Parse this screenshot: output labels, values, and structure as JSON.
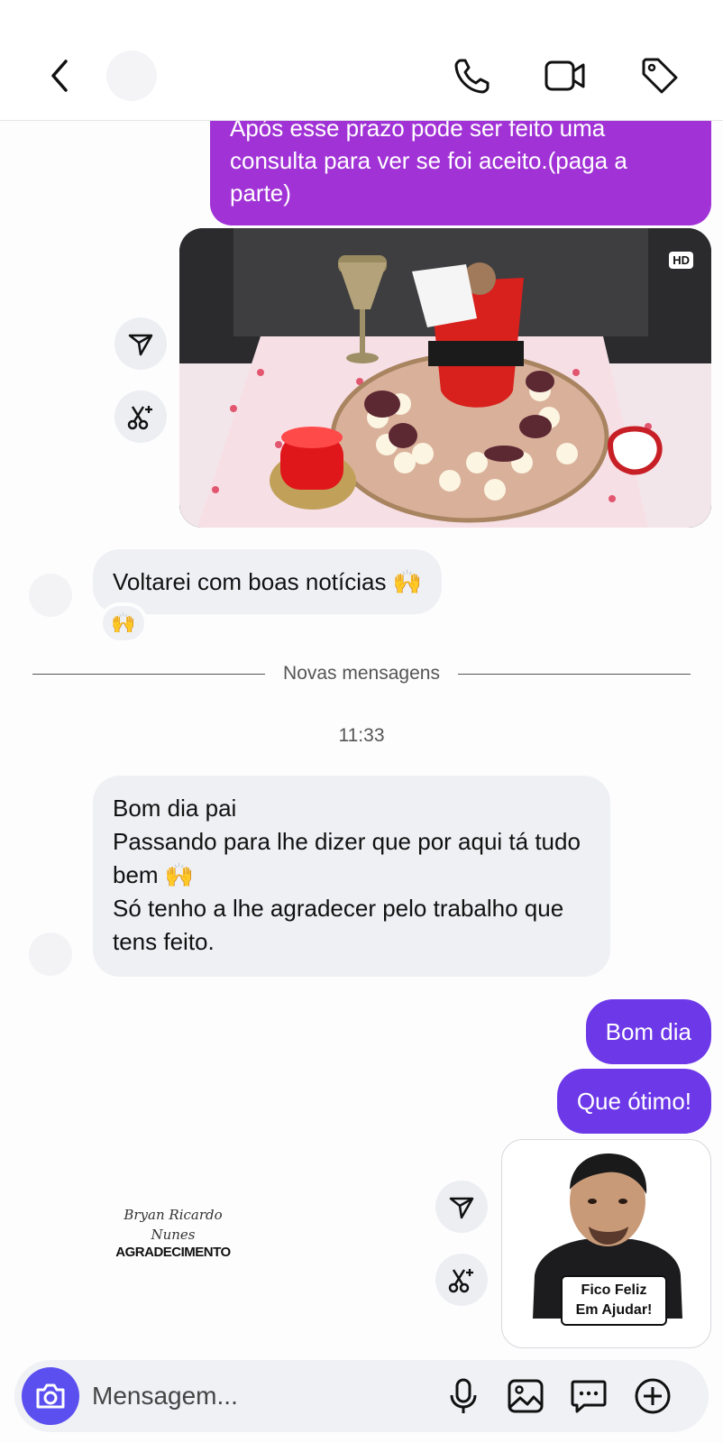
{
  "header": {
    "back_icon": "chevron-left-icon",
    "icons": [
      "phone-icon",
      "video-camera-icon",
      "tag-icon"
    ]
  },
  "messages": {
    "m1_text": "Após esse prazo pode ser feito uma consulta para ver se foi aceito.(paga a parte)",
    "photo_badge": "HD",
    "m2_text": "Voltarei com boas notícias 🙌",
    "m2_reaction": "🙌",
    "divider_label": "Novas mensagens",
    "timestamp": "11:33",
    "m3_lines": [
      "Bom dia pai",
      "Passando para lhe dizer que por aqui tá tudo bem 🙌",
      "Só tenho a lhe agradecer pelo trabalho que tens feito."
    ],
    "m4_text": "Bom dia",
    "m5_text": "Que ótimo!",
    "sticker_left": {
      "sig_line1": "Bryan Ricardo",
      "sig_line2": "Nunes",
      "caption": "AGRADECIMENTO"
    },
    "sticker_right": {
      "caption": "Fico Feliz Em Ajudar!"
    }
  },
  "composer": {
    "placeholder": "Mensagem...",
    "icons": [
      "camera-icon",
      "microphone-icon",
      "gallery-icon",
      "chat-sticker-icon",
      "plus-icon"
    ]
  },
  "colors": {
    "outgoing_purple": "#a133d6",
    "outgoing_indigo": "#6c38e8",
    "incoming_gray": "#eff0f4",
    "camera_button": "#5b4ff0"
  }
}
